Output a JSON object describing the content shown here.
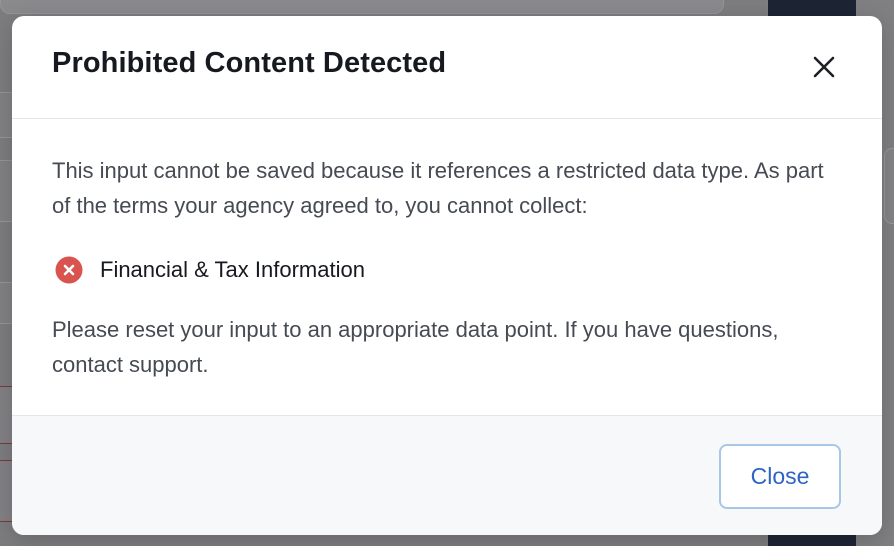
{
  "modal": {
    "title": "Prohibited Content Detected",
    "close_icon": "close-icon",
    "body": {
      "message": "This input cannot be saved because it references a restricted data type. As part of the terms your agency agreed to, you cannot collect:",
      "restricted_items": [
        {
          "icon": "error-circle-icon",
          "label": "Financial & Tax Information"
        }
      ],
      "instruction": "Please reset your input to an appropriate data point. If you have questions, contact support."
    },
    "footer": {
      "close_label": "Close"
    }
  },
  "colors": {
    "title_text": "#16191f",
    "body_text": "#464b53",
    "error_red": "#d9534f",
    "button_text": "#2f63c4",
    "button_border": "#a8c6e6",
    "footer_bg": "#f7f8fa",
    "backdrop": "#7d7d80"
  }
}
